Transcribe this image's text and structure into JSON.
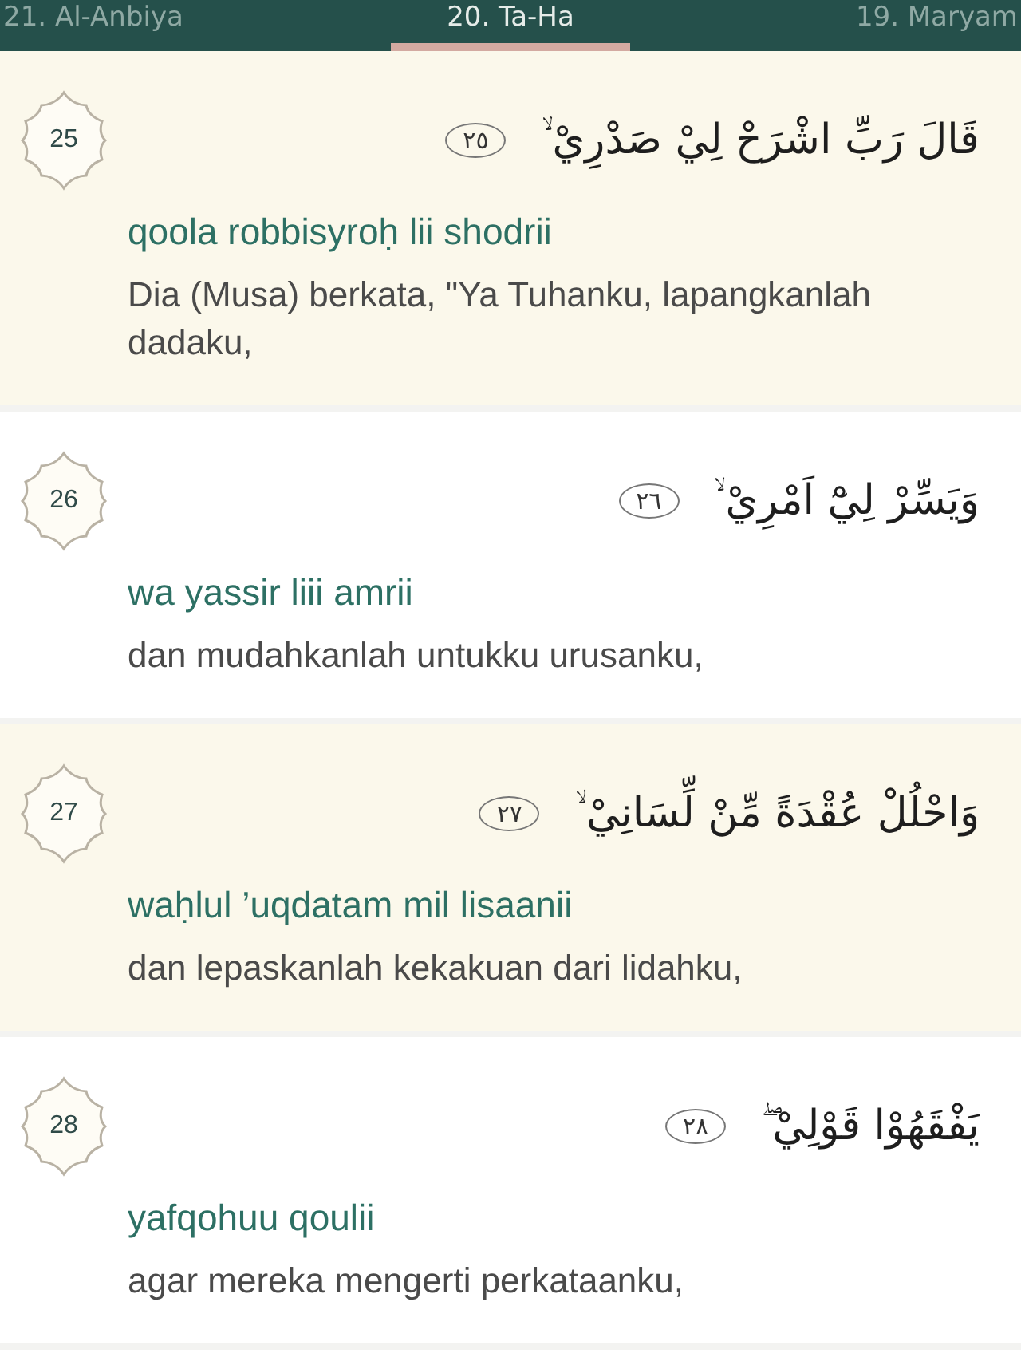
{
  "tabs": [
    {
      "label": "21. Al-Anbiya",
      "selected": false
    },
    {
      "label": "20. Ta-Ha",
      "selected": true
    },
    {
      "label": "19. Maryam",
      "selected": false
    }
  ],
  "verses": [
    {
      "number": "25",
      "arabic": "قَالَ رَبِّ اشْرَحْ لِيْ صَدْرِيْ ۙ",
      "ayah_mark": "٢٥",
      "transliteration": "qoola robbisyroḥ lii shodrii",
      "translation": "Dia (Musa) berkata, \"Ya Tuhanku, lapangkanlah dadaku,",
      "highlighted": true
    },
    {
      "number": "26",
      "arabic": "وَيَسِّرْ لِيْٓ اَمْرِيْ ۙ",
      "ayah_mark": "٢٦",
      "transliteration": "wa yassir liii amrii",
      "translation": "dan mudahkanlah untukku urusanku,",
      "highlighted": false
    },
    {
      "number": "27",
      "arabic": "وَاحْلُلْ عُقْدَةً مِّنْ لِّسَانِيْ ۙ",
      "ayah_mark": "٢٧",
      "transliteration": "waḥlul ’uqdatam mil lisaanii",
      "translation": "dan lepaskanlah kekakuan dari lidahku,",
      "highlighted": true
    },
    {
      "number": "28",
      "arabic": "يَفْقَهُوْا قَوْلِيْ ۖ",
      "ayah_mark": "٢٨",
      "transliteration": "yafqohuu qoulii",
      "translation": "agar mereka mengerti perkataanku,",
      "highlighted": false
    }
  ]
}
